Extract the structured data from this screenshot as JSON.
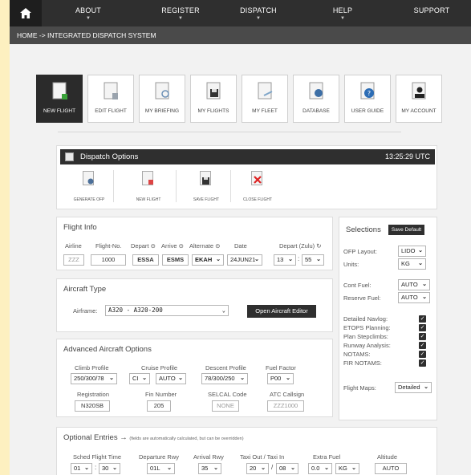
{
  "nav": {
    "items": [
      "ABOUT",
      "REGISTER",
      "DISPATCH",
      "HELP",
      "SUPPORT"
    ]
  },
  "breadcrumb": "HOME -> INTEGRATED DISPATCH SYSTEM",
  "tiles": [
    "NEW FLIGHT",
    "EDIT FLIGHT",
    "MY BRIEFING",
    "MY FLIGHTS",
    "MY FLEET",
    "DATABASE",
    "USER GUIDE",
    "MY ACCOUNT"
  ],
  "dispatch_options": {
    "title": "Dispatch Options",
    "clock": "13:25:29 UTC",
    "buttons": [
      "GENERATE OFP",
      "NEW FLIGHT",
      "SAVE FLIGHT",
      "CLOSE FLIGHT"
    ]
  },
  "flight_info": {
    "title": "Flight Info",
    "labels": {
      "airline": "Airline",
      "flight_no": "Flight-No.",
      "depart": "Depart ⊝",
      "arrive": "Arrive ⊝",
      "alternate": "Alternate ⊝",
      "date": "Date",
      "depart_zulu": "Depart (Zulu) ↻"
    },
    "values": {
      "airline": "ZZZ",
      "flight_no": "1000",
      "depart": "ESSA",
      "arrive": "ESMS",
      "alternate": "EKAH",
      "date": "24JUN21",
      "hour": "13",
      "minute": "55"
    }
  },
  "aircraft_type": {
    "title": "Aircraft Type",
    "airframe_label": "Airframe:",
    "airframe_value": "A320 - A320-200",
    "editor_button": "Open Aircraft Editor"
  },
  "advanced": {
    "title": "Advanced Aircraft Options",
    "labels": {
      "climb": "Climb Profile",
      "cruise": "Cruise Profile",
      "descent": "Descent Profile",
      "fuel_factor": "Fuel Factor",
      "registration": "Registration",
      "fin": "Fin Number",
      "selcal": "SELCAL Code",
      "atc": "ATC Callsign"
    },
    "values": {
      "climb": "250/300/78",
      "cruise_mode": "CI",
      "cruise_level": "AUTO",
      "descent": "78/300/250",
      "fuel_factor": "P00",
      "registration": "N320SB",
      "fin": "205",
      "selcal": "NONE",
      "atc": "ZZZ1000"
    }
  },
  "optional": {
    "title": "Optional Entries",
    "arrow": "→",
    "note": "(fields are automatically calculated, but can be overridden)",
    "labels": {
      "sched": "Sched Flight Time",
      "dep_rwy": "Departure Rwy",
      "arr_rwy": "Arrival Rwy",
      "taxi": "Taxi Out / Taxi In",
      "extra_fuel": "Extra Fuel",
      "altitude": "Altitude"
    },
    "values": {
      "sched_h": "01",
      "sched_m": "30",
      "dep_rwy": "01L",
      "arr_rwy": "35",
      "taxi_out": "20",
      "taxi_in": "08",
      "extra_fuel": "0.0",
      "fuel_unit": "KG",
      "altitude": "AUTO"
    }
  },
  "selections": {
    "title": "Selections",
    "save_default": "Save Default",
    "ofp_layout_label": "OFP Layout:",
    "ofp_layout": "LIDO",
    "units_label": "Units:",
    "units": "KG",
    "cont_fuel_label": "Cont Fuel:",
    "cont_fuel": "AUTO",
    "reserve_fuel_label": "Reserve Fuel:",
    "reserve_fuel": "AUTO",
    "checks": [
      "Detailed Navlog:",
      "ETOPS Planning:",
      "Plan Stepclimbs:",
      "Runway Analysis:",
      "NOTAMS:",
      "FIR NOTAMS:"
    ],
    "flight_maps_label": "Flight Maps:",
    "flight_maps": "Detailed"
  }
}
